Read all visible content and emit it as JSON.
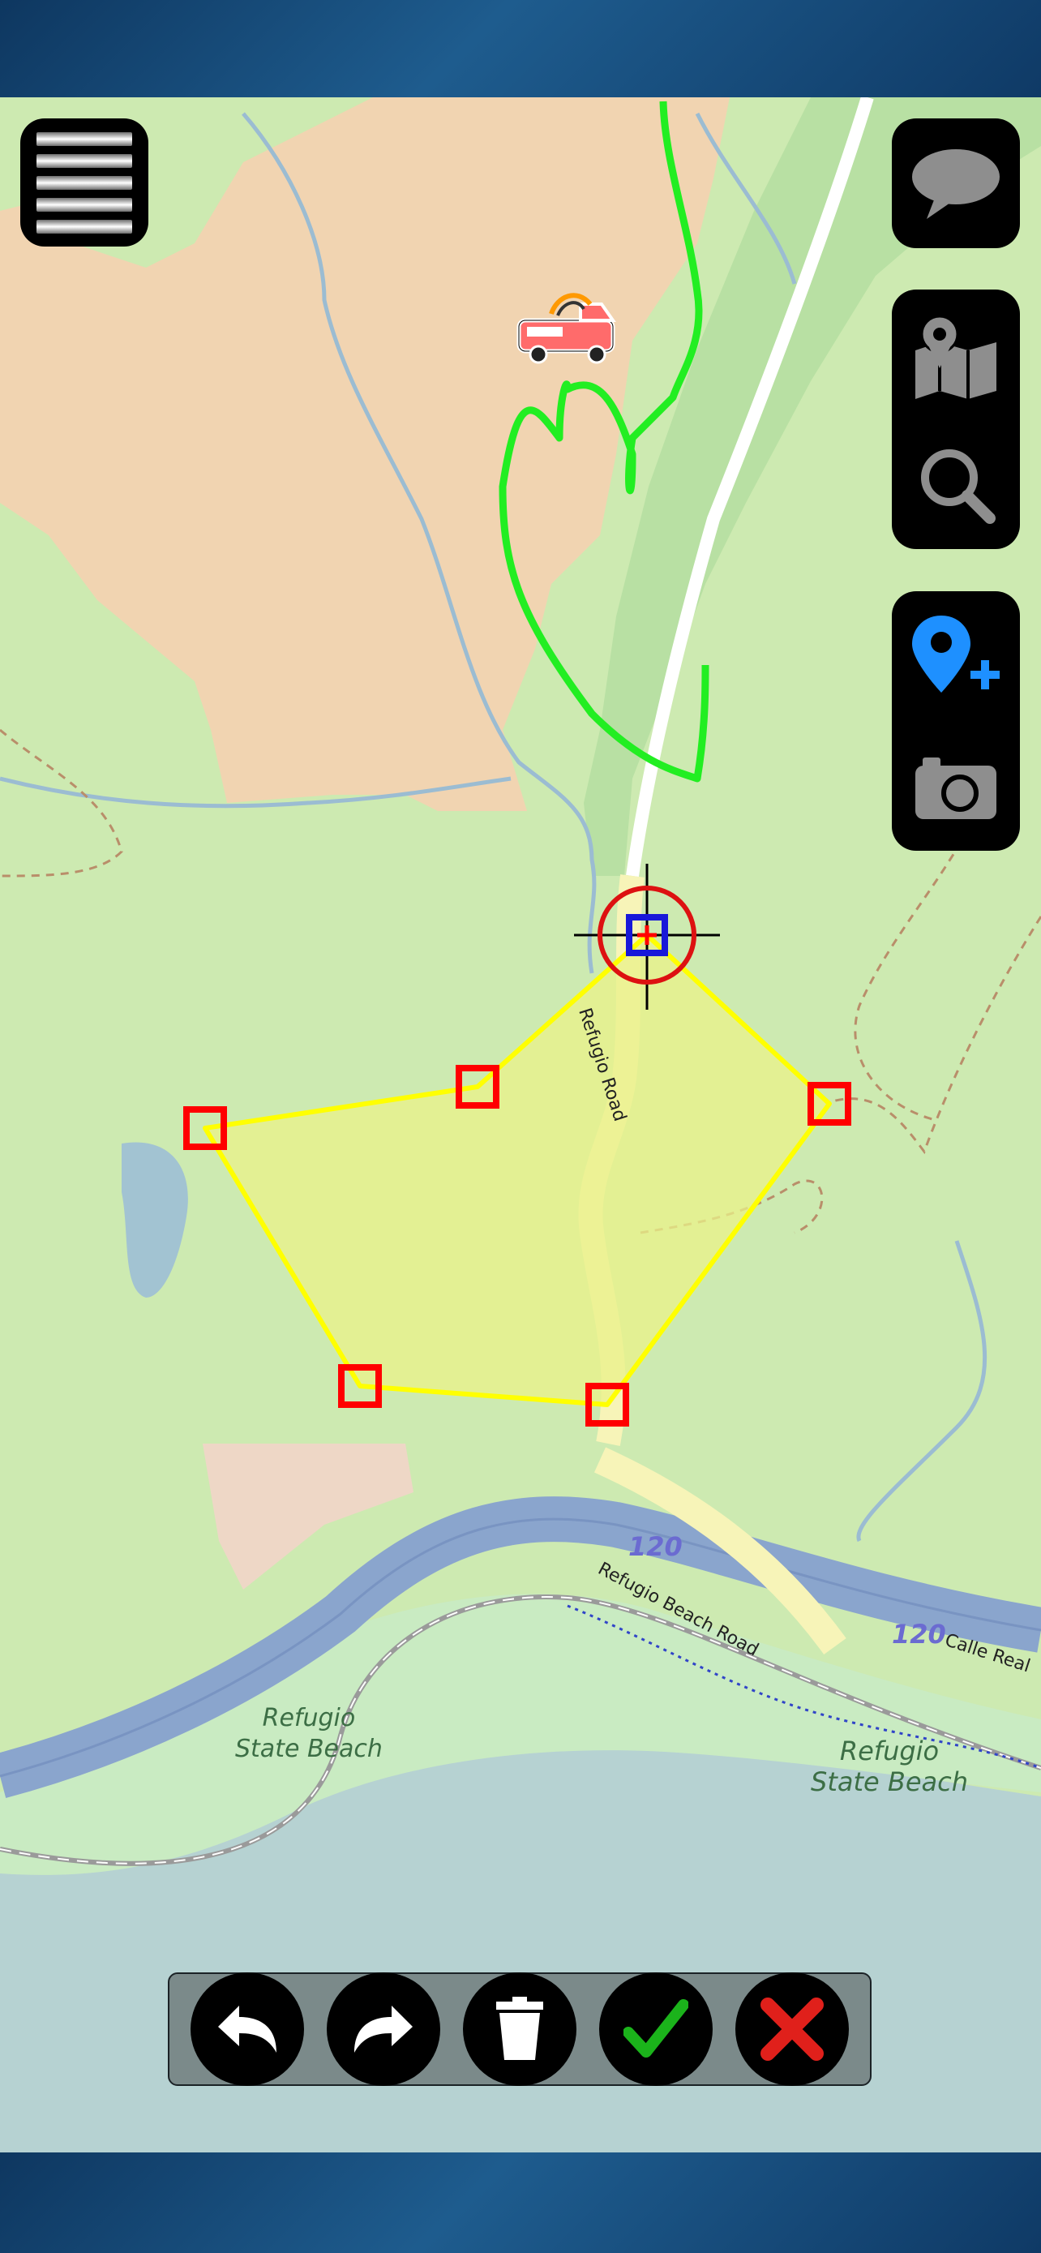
{
  "top_bar": {},
  "map": {
    "labels": {
      "road_refugio": "Refugio Road",
      "road_refugio_beach": "Refugio Beach Road",
      "shield_1": "120",
      "shield_2": "120",
      "calle_real": "Calle Real",
      "state_beach_1_line1": "Refugio",
      "state_beach_1_line2": "State Beach",
      "state_beach_2_line1": "Refugio",
      "state_beach_2_line2": "State Beach"
    },
    "polygon": {
      "fill_color": "#eaf28a",
      "stroke_color": "#ffff00",
      "vertex_color": "#ff0000"
    },
    "gps_track_color": "#22ee22"
  },
  "buttons": {
    "menu": {
      "icon": "menu-icon"
    },
    "chat": {
      "icon": "chat-bubble-icon"
    },
    "map_layers": {
      "icon": "map-pin-icon"
    },
    "search": {
      "icon": "search-icon"
    },
    "add_marker": {
      "icon": "add-location-icon",
      "accent": "#1e90ff"
    },
    "camera": {
      "icon": "camera-icon"
    }
  },
  "toolbar": {
    "undo": {
      "icon": "undo-icon"
    },
    "redo": {
      "icon": "redo-icon"
    },
    "delete": {
      "icon": "trash-icon"
    },
    "confirm": {
      "icon": "checkmark-icon",
      "color": "#1bb31b"
    },
    "cancel": {
      "icon": "close-icon",
      "color": "#e0201b"
    }
  }
}
